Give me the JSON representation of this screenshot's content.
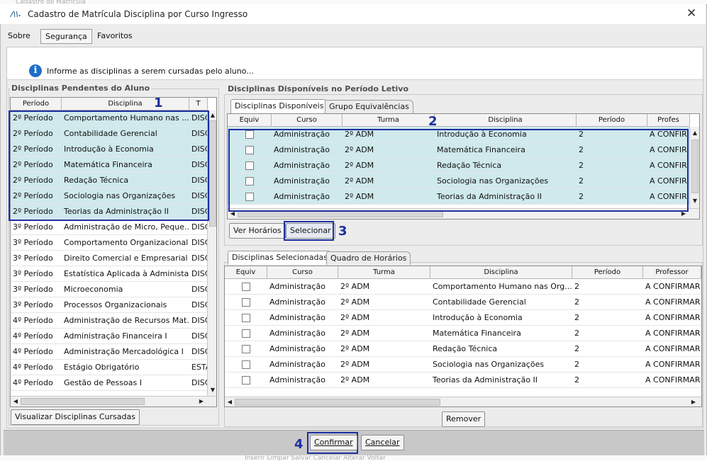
{
  "window": {
    "title": "Cadastro de Matrícula Disciplina por Curso Ingresso"
  },
  "menu": [
    {
      "label": "Sobre"
    },
    {
      "label": "Segurança"
    },
    {
      "label": "Favoritos"
    }
  ],
  "info": {
    "text": "Informe as disciplinas a serem cursadas pelo aluno..."
  },
  "pendentes": {
    "title": "Disciplinas Pendentes do Aluno",
    "columns": [
      "Período",
      "Disciplina",
      "T"
    ],
    "rows": [
      {
        "periodo": "2º Período",
        "disciplina": "Comportamento Humano nas ...",
        "t": "DISC",
        "hl": true
      },
      {
        "periodo": "2º Período",
        "disciplina": "Contabilidade Gerencial",
        "t": "DISC",
        "hl": true
      },
      {
        "periodo": "2º Período",
        "disciplina": "Introdução à Economia",
        "t": "DISC",
        "hl": true
      },
      {
        "periodo": "2º Período",
        "disciplina": "Matemática Financeira",
        "t": "DISC",
        "hl": true
      },
      {
        "periodo": "2º Período",
        "disciplina": "Redação Técnica",
        "t": "DISC",
        "hl": true
      },
      {
        "periodo": "2º Período",
        "disciplina": "Sociologia nas Organizações",
        "t": "DISC",
        "hl": true
      },
      {
        "periodo": "2º Período",
        "disciplina": "Teorias da Administração II",
        "t": "DISC",
        "hl": true
      },
      {
        "periodo": "3º Período",
        "disciplina": "Administração de Micro, Peque...",
        "t": "DISC",
        "hl": false
      },
      {
        "periodo": "3º Período",
        "disciplina": "Comportamento Organizacional",
        "t": "DISC",
        "hl": false
      },
      {
        "periodo": "3º Período",
        "disciplina": "Direito Comercial e Empresarial",
        "t": "DISC",
        "hl": false
      },
      {
        "periodo": "3º Período",
        "disciplina": "Estatística Aplicada à Administa...",
        "t": "DISC",
        "hl": false
      },
      {
        "periodo": "3º Período",
        "disciplina": "Microeconomia",
        "t": "DISC",
        "hl": false
      },
      {
        "periodo": "3º Período",
        "disciplina": "Processos Organizacionais",
        "t": "DISC",
        "hl": false
      },
      {
        "periodo": "4º Período",
        "disciplina": "Administração de Recursos Mat...",
        "t": "DISC",
        "hl": false
      },
      {
        "periodo": "4º Período",
        "disciplina": "Administração Financeira I",
        "t": "DISC",
        "hl": false
      },
      {
        "periodo": "4º Período",
        "disciplina": "Administração Mercadológica I",
        "t": "DISC",
        "hl": false
      },
      {
        "periodo": "4º Período",
        "disciplina": "Estágio Obrigatório",
        "t": "ESTA",
        "hl": false
      },
      {
        "periodo": "4º Período",
        "disciplina": "Gestão de Pessoas I",
        "t": "DISC",
        "hl": false
      }
    ],
    "button": "Visualizar Disciplinas Cursadas"
  },
  "disponiveis": {
    "title": "Disciplinas Disponíveis no Período Letivo",
    "tabs": [
      "Disciplinas Disponíveis",
      "Grupo Equivalências"
    ],
    "columns": [
      "Equiv",
      "Curso",
      "Turma",
      "Disciplina",
      "Período",
      "Profes"
    ],
    "rows": [
      {
        "curso": "Administração",
        "turma": "2º ADM",
        "disciplina": "Introdução à Economia",
        "periodo": "2",
        "professor": "A CONFIR"
      },
      {
        "curso": "Administração",
        "turma": "2º ADM",
        "disciplina": "Matemática Financeira",
        "periodo": "2",
        "professor": "A CONFIR"
      },
      {
        "curso": "Administração",
        "turma": "2º ADM",
        "disciplina": "Redação Técnica",
        "periodo": "2",
        "professor": "A CONFIR"
      },
      {
        "curso": "Administração",
        "turma": "2º ADM",
        "disciplina": "Sociologia nas Organizações",
        "periodo": "2",
        "professor": "A CONFIR"
      },
      {
        "curso": "Administração",
        "turma": "2º ADM",
        "disciplina": "Teorias da Administração II",
        "periodo": "2",
        "professor": "A CONFIR"
      }
    ],
    "btn_horarios": "Ver Horários",
    "btn_selecionar": "Selecionar"
  },
  "selecionadas": {
    "tabs": [
      "Disciplinas Selecionadas",
      "Quadro de Horários"
    ],
    "columns": [
      "Equiv",
      "Curso",
      "Turma",
      "Disciplina",
      "Período",
      "Professor"
    ],
    "rows": [
      {
        "curso": "Administração",
        "turma": "2º ADM",
        "disciplina": "Comportamento Humano nas Org...",
        "periodo": "2",
        "professor": "A CONFIRMAR"
      },
      {
        "curso": "Administração",
        "turma": "2º ADM",
        "disciplina": "Contabilidade Gerencial",
        "periodo": "2",
        "professor": "A CONFIRMAR"
      },
      {
        "curso": "Administração",
        "turma": "2º ADM",
        "disciplina": "Introdução à Economia",
        "periodo": "2",
        "professor": "A CONFIRMAR"
      },
      {
        "curso": "Administração",
        "turma": "2º ADM",
        "disciplina": "Matemática Financeira",
        "periodo": "2",
        "professor": "A CONFIRMAR"
      },
      {
        "curso": "Administração",
        "turma": "2º ADM",
        "disciplina": "Redação Técnica",
        "periodo": "2",
        "professor": "A CONFIRMAR"
      },
      {
        "curso": "Administração",
        "turma": "2º ADM",
        "disciplina": "Sociologia nas Organizações",
        "periodo": "2",
        "professor": "A CONFIRMAR"
      },
      {
        "curso": "Administração",
        "turma": "2º ADM",
        "disciplina": "Teorias da Administração II",
        "periodo": "2",
        "professor": "A CONFIRMAR"
      }
    ],
    "btn_remover": "Remover"
  },
  "footer": {
    "confirmar": "Confirmar",
    "cancelar": "Cancelar"
  },
  "annotations": [
    "1",
    "2",
    "3",
    "4"
  ],
  "background": {
    "top_text": "Cadastro de Matrícula",
    "bottom_text": "Inserir    Limpar    Salvar    Cancelar    Alterar    Voltar"
  },
  "icons": {
    "app": "logo-icon",
    "close": "close-icon",
    "info": "info-icon"
  },
  "colors": {
    "highlight": "#cfe9ec",
    "annotation": "#1c2fa0",
    "info": "#1f6fc7"
  }
}
